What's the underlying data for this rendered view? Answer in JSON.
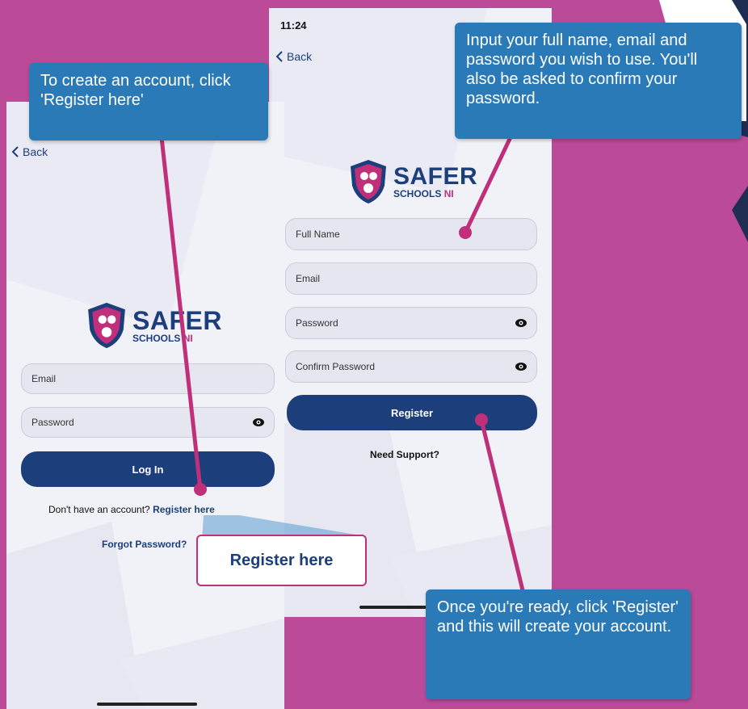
{
  "colors": {
    "background": "#bb4a98",
    "navy": "#1c3f7c",
    "pink": "#c0307a",
    "callout": "#2a7ab8"
  },
  "login_screen": {
    "back_label": "Back",
    "logo": {
      "safer": "SAFER",
      "schools": "SCHOOLS",
      "ni": "NI",
      "icon": "shield-icon"
    },
    "email_placeholder": "Email",
    "password_placeholder": "Password",
    "login_button": "Log In",
    "no_account_text": "Don't have an account?",
    "register_link": "Register here",
    "forgot_password": "Forgot Password?"
  },
  "register_screen": {
    "time": "11:24",
    "back_label": "Back",
    "logo": {
      "safer": "SAFER",
      "schools": "SCHOOLS",
      "ni": "NI",
      "icon": "shield-icon"
    },
    "full_name_placeholder": "Full Name",
    "email_placeholder": "Email",
    "password_placeholder": "Password",
    "confirm_password_placeholder": "Confirm Password",
    "register_button": "Register",
    "need_support": "Need Support?"
  },
  "callouts": {
    "create_account": "To create an account, click 'Register here'",
    "input_details": "Input your full name, email and password you wish to use. You'll also be asked to confirm your password.",
    "once_ready": "Once you're ready, click 'Register' and this will create your account."
  },
  "zoom_label": "Register here"
}
